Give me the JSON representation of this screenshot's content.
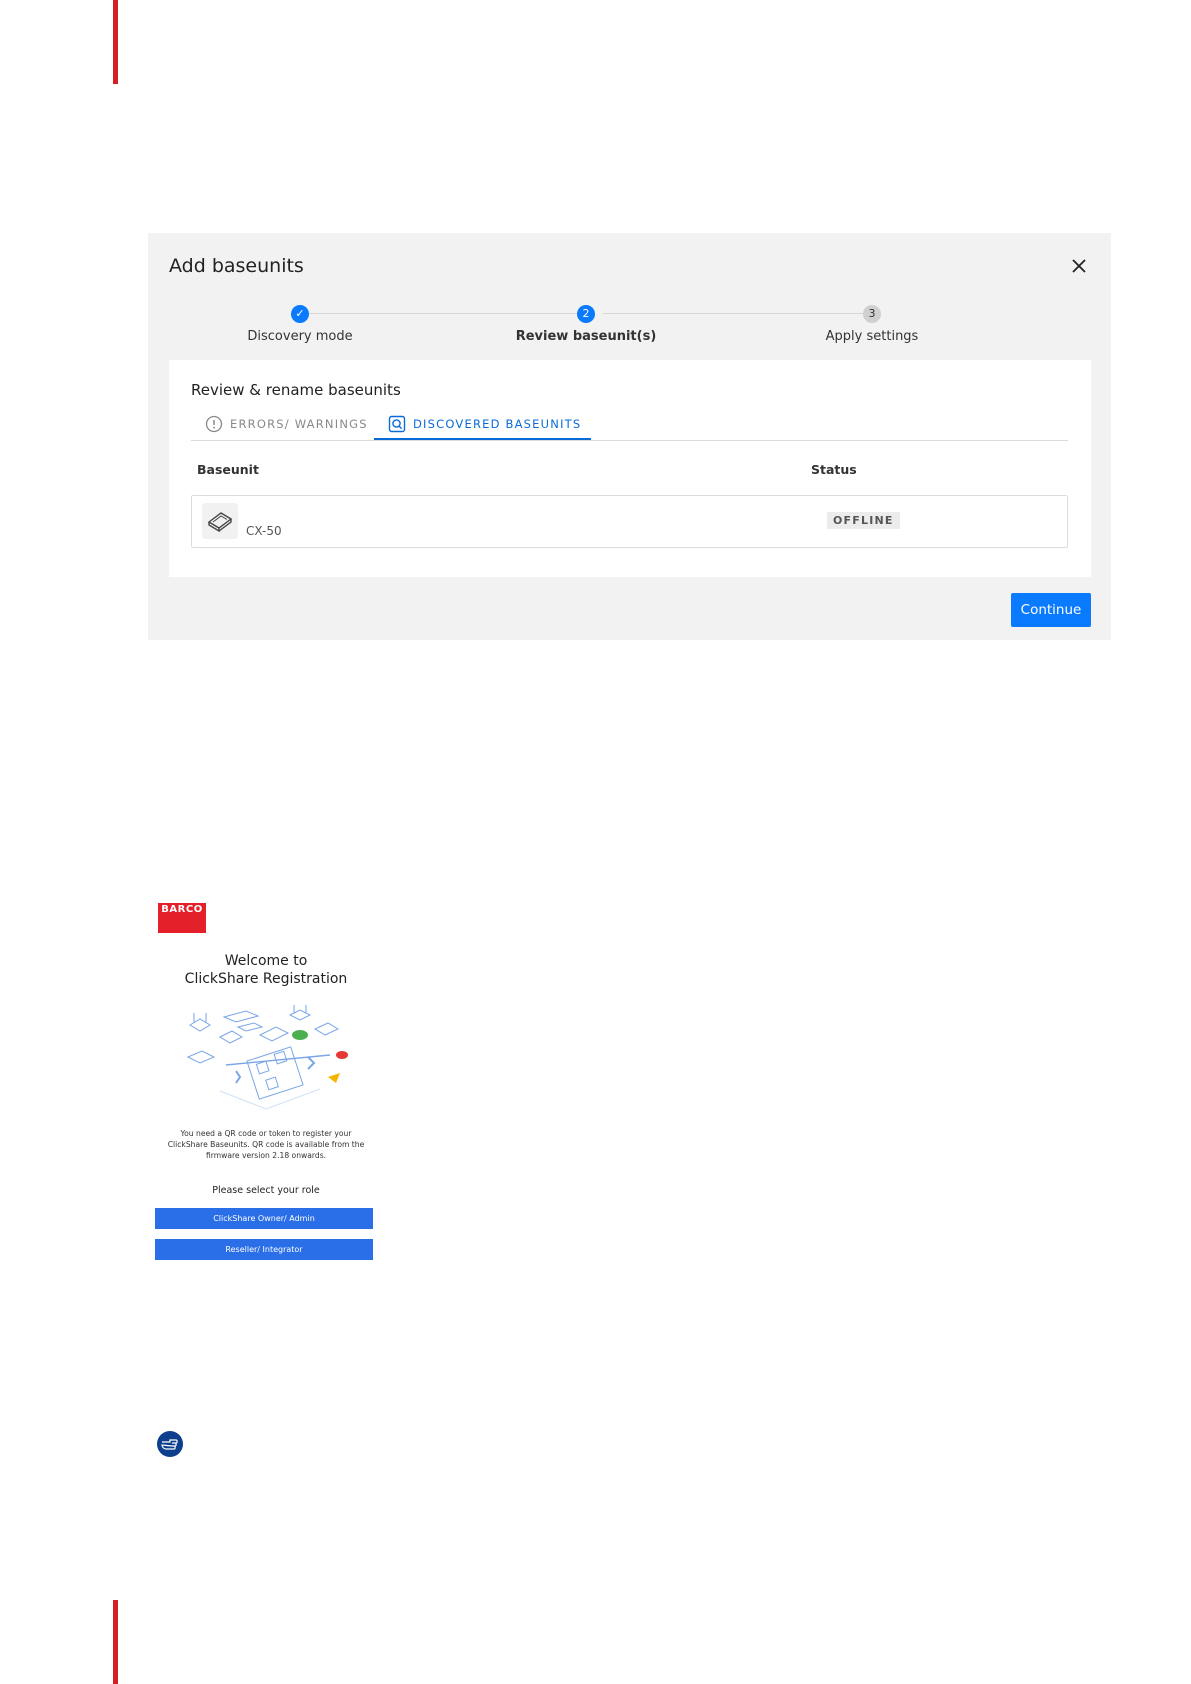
{
  "dialog": {
    "title": "Add baseunits",
    "steps": [
      {
        "number": "✓",
        "label": "Discovery mode"
      },
      {
        "number": "2",
        "label": "Review baseunit(s)"
      },
      {
        "number": "3",
        "label": "Apply settings"
      }
    ],
    "card": {
      "title": "Review & rename baseunits",
      "tabs": [
        {
          "label": "ERRORS/ WARNINGS"
        },
        {
          "label": "DISCOVERED BASEUNITS"
        }
      ],
      "columns": {
        "baseunit": "Baseunit",
        "status": "Status"
      },
      "rows": [
        {
          "name": "CX-50",
          "status": "OFFLINE"
        }
      ]
    },
    "continue_label": "Continue"
  },
  "registration": {
    "logo_text": "BARCO",
    "welcome_line1": "Welcome to",
    "welcome_line2": "ClickShare Registration",
    "info_line1": "You need a QR code or token to register your",
    "info_line2": "ClickShare Baseunits. QR code is available from the",
    "info_line3": "firmware version 2.18 onwards.",
    "role_prompt": "Please select your role",
    "owner_button": "ClickShare Owner/ Admin",
    "reseller_button": "Reseller/ Integrator"
  },
  "colors": {
    "accent": "#0a7aff",
    "brand_red": "#d51f26",
    "tip_icon": "#0d3f8c"
  }
}
